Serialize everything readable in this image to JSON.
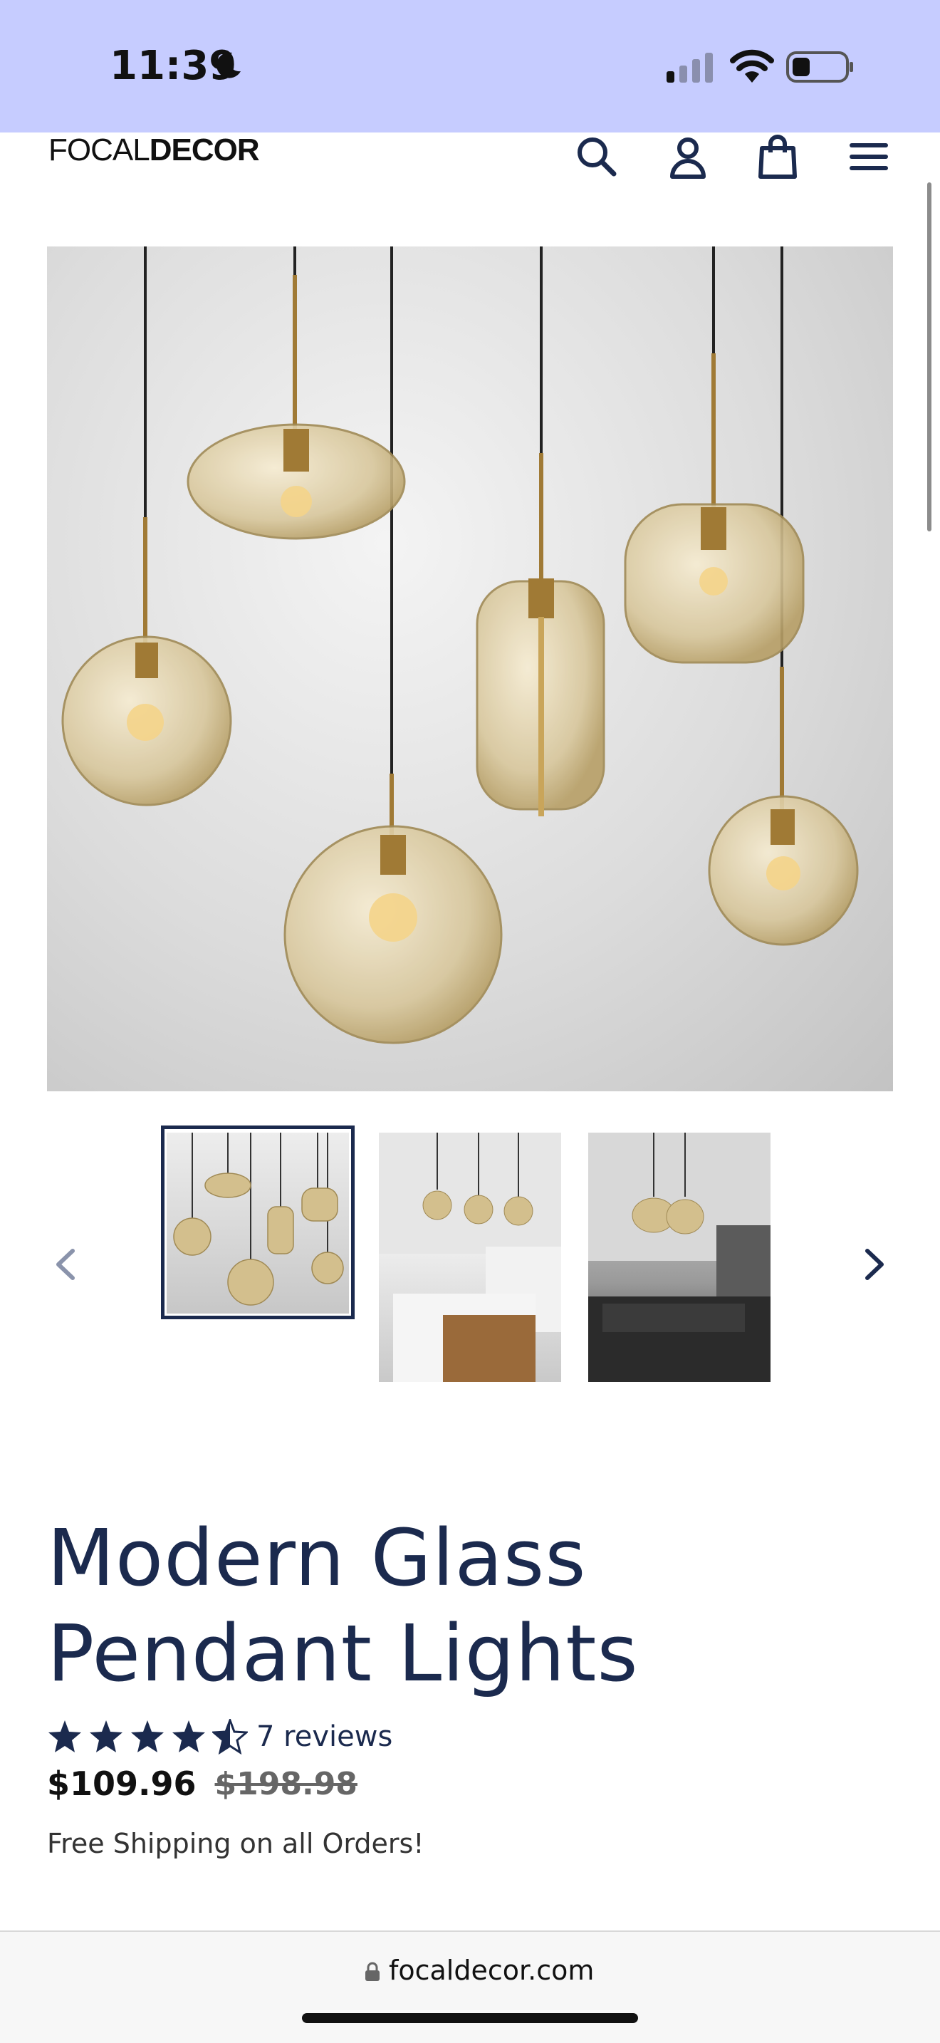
{
  "status_bar": {
    "time": "11:39"
  },
  "header": {
    "logo_light": "FOCAL",
    "logo_bold": "DECOR"
  },
  "gallery": {
    "thumbnails": [
      "thumbnail-1",
      "thumbnail-2",
      "thumbnail-3"
    ],
    "selected_index": 0
  },
  "product": {
    "title": "Modern Glass Pendant Lights",
    "rating": 4.5,
    "rating_max": 5,
    "reviews": "7 reviews",
    "sale_price": "$109.96",
    "compare_price": "$198.98",
    "shipping_note": "Free Shipping on all Orders!"
  },
  "browser": {
    "url": "focaldecor.com"
  },
  "colors": {
    "status_bar_bg": "#c6ccff",
    "brand_navy": "#1b2a4e",
    "glass_amber": "#c9b27a",
    "brass": "#a07a35"
  }
}
